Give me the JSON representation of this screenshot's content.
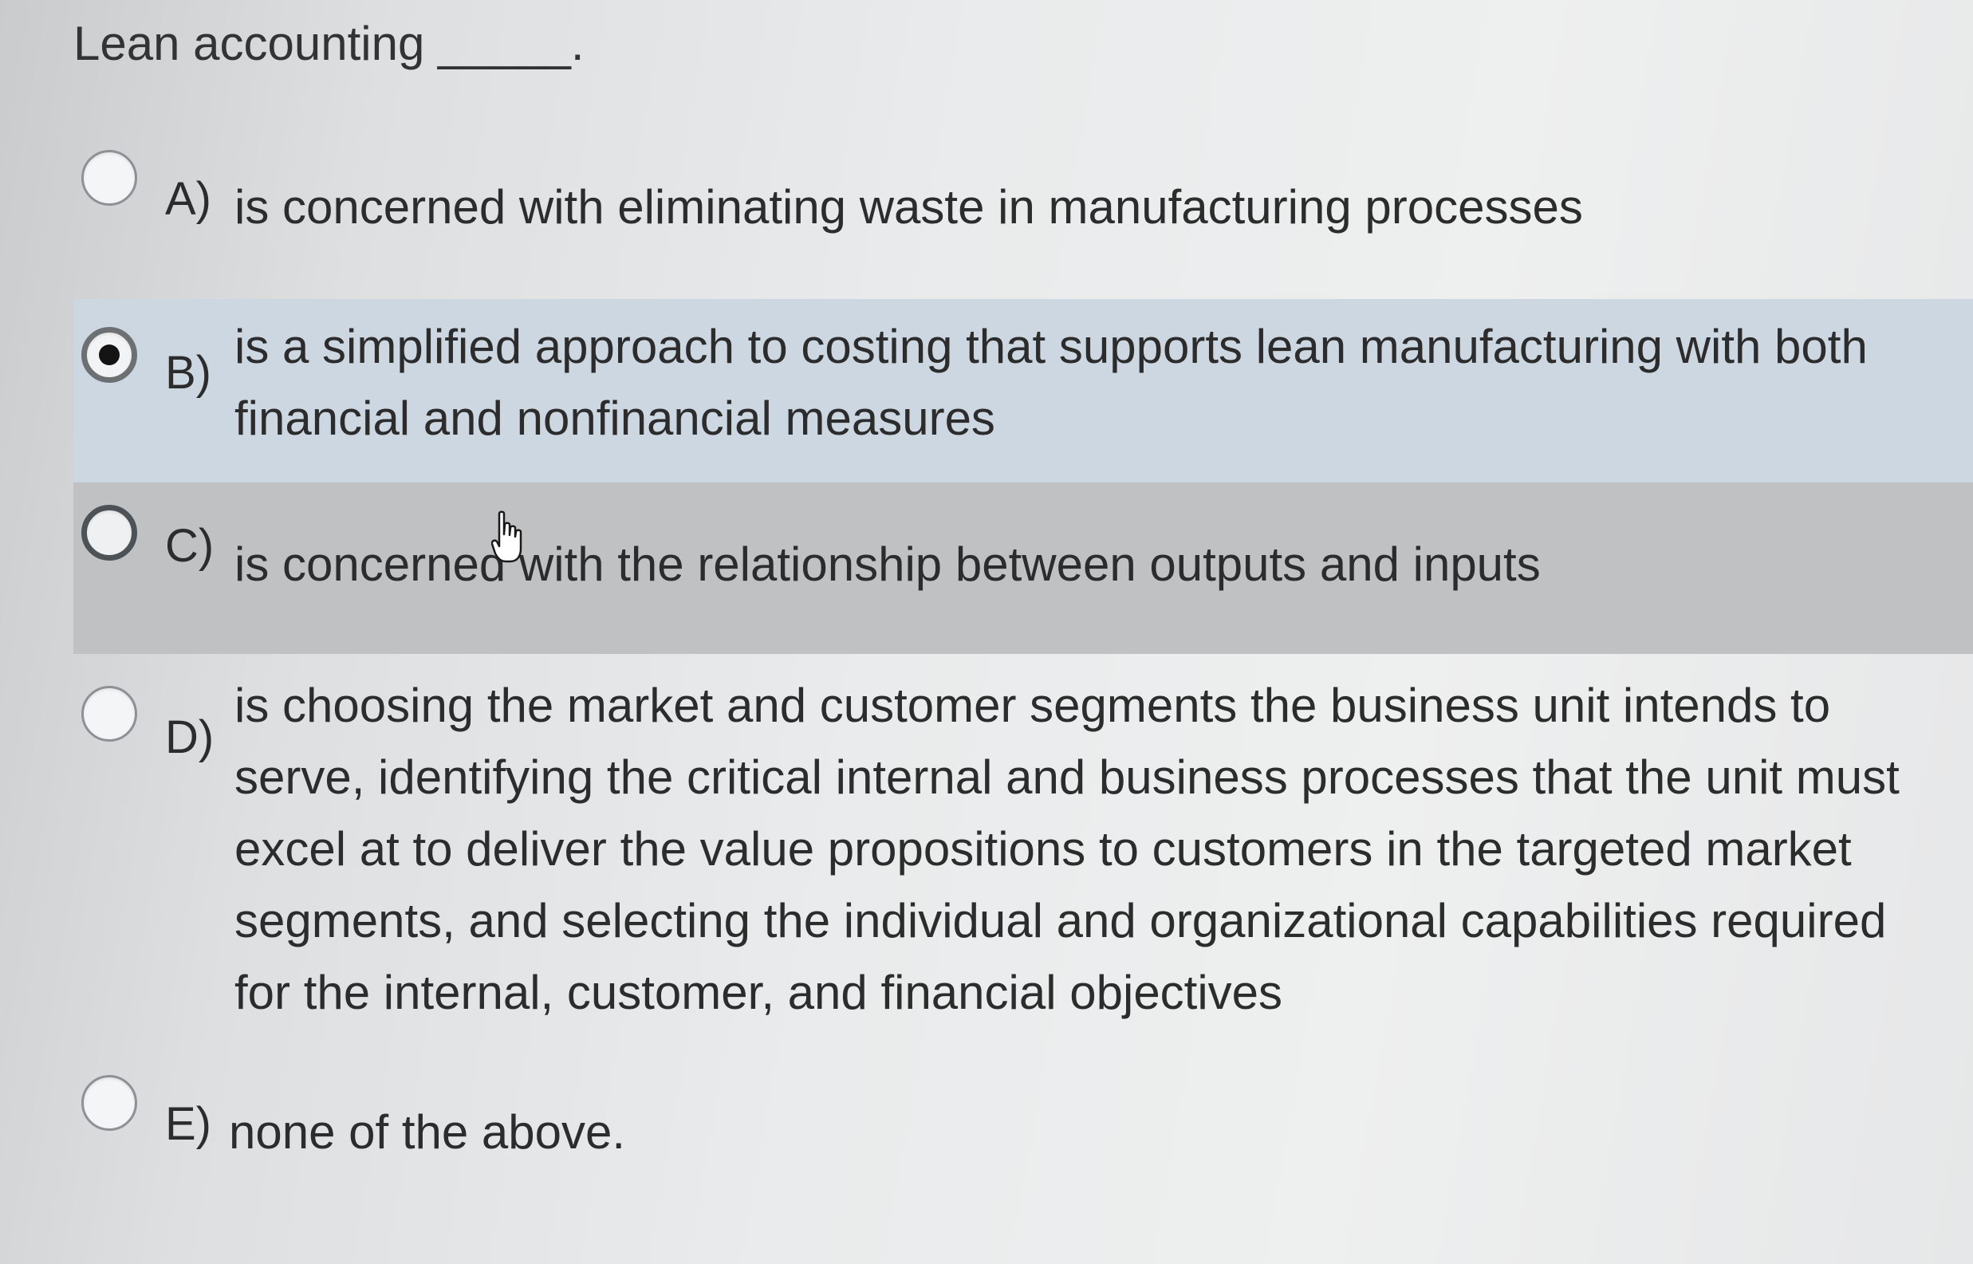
{
  "question": "Lean accounting _____.",
  "options": [
    {
      "letter": "A)",
      "text": "is concerned with eliminating waste in manufacturing processes"
    },
    {
      "letter": "B)",
      "text": "is a simplified approach to costing that supports lean manufacturing with both financial and nonfinancial measures"
    },
    {
      "letter": "C)",
      "text": "is concerned with the relationship between outputs and inputs"
    },
    {
      "letter": "D)",
      "text": "is choosing the market and customer segments the business unit intends to serve, identifying the critical internal and business processes that the unit must excel at to deliver the value propositions to customers in the targeted market segments, and selecting the individual and organizational capabilities required for the internal, customer, and financial objectives"
    },
    {
      "letter": "E)",
      "text": "none of the above."
    }
  ],
  "selected_option": "B)",
  "icons": {
    "radio": "radio-button-icon",
    "cursor": "hand-pointer-icon"
  },
  "colors": {
    "selected_row": "#cdd7e2",
    "hovered_row": "#bfc1c3",
    "text": "#2c2c2c"
  }
}
